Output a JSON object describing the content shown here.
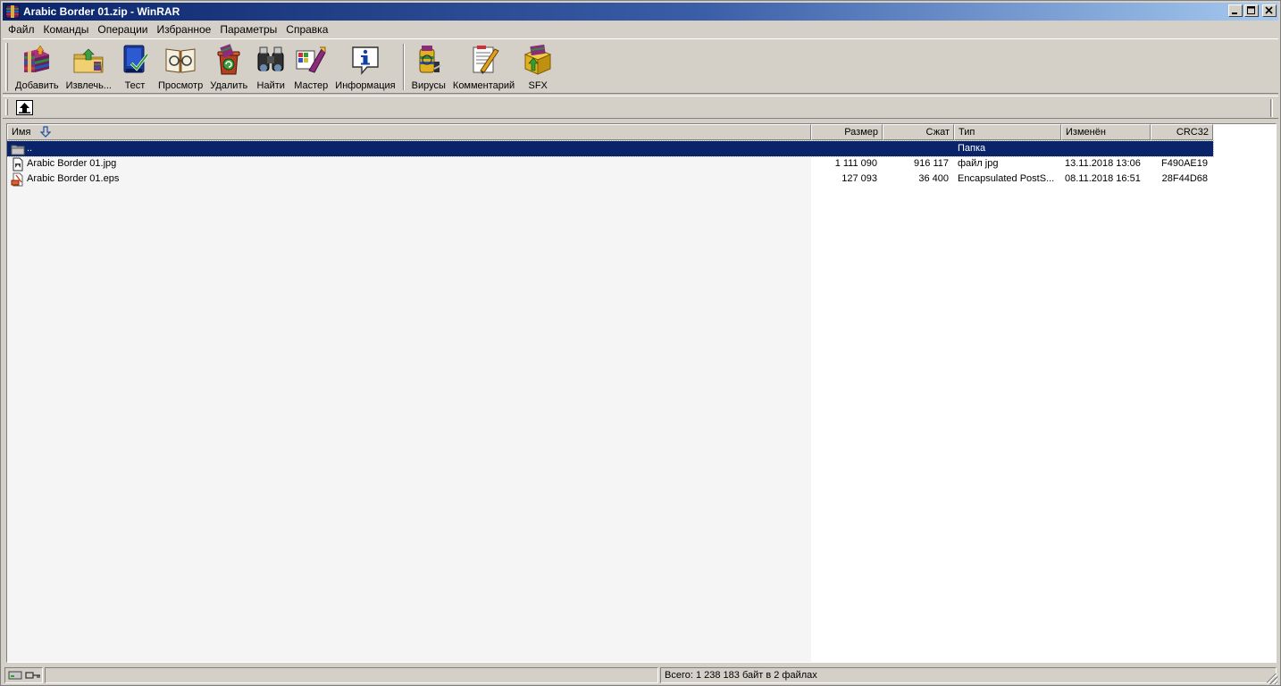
{
  "window": {
    "title": "Arabic Border 01.zip - WinRAR",
    "minimize": "_",
    "maximize": "□",
    "close": "✕"
  },
  "menu": [
    "Файл",
    "Команды",
    "Операции",
    "Избранное",
    "Параметры",
    "Справка"
  ],
  "toolbar": [
    {
      "label": "Добавить",
      "icon": "add-archive-icon"
    },
    {
      "label": "Извлечь...",
      "icon": "extract-icon"
    },
    {
      "label": "Тест",
      "icon": "test-icon"
    },
    {
      "label": "Просмотр",
      "icon": "view-icon"
    },
    {
      "label": "Удалить",
      "icon": "delete-icon"
    },
    {
      "label": "Найти",
      "icon": "find-icon"
    },
    {
      "label": "Мастер",
      "icon": "wizard-icon"
    },
    {
      "label": "Информация",
      "icon": "info-icon"
    },
    {
      "label": "Вирусы",
      "icon": "virus-scan-icon"
    },
    {
      "label": "Комментарий",
      "icon": "comment-icon"
    },
    {
      "label": "SFX",
      "icon": "sfx-icon"
    }
  ],
  "columns": {
    "name": "Имя",
    "size": "Размер",
    "packed": "Сжат",
    "type": "Тип",
    "modified": "Изменён",
    "crc": "CRC32"
  },
  "files": [
    {
      "name": "..",
      "size": "",
      "packed": "",
      "type": "Папка",
      "modified": "",
      "crc": "",
      "icon": "folder-up-icon",
      "selected": true
    },
    {
      "name": "Arabic Border 01.jpg",
      "size": "1 111 090",
      "packed": "916 117",
      "type": "файл jpg",
      "modified": "13.11.2018 13:06",
      "crc": "F490AE19",
      "icon": "jpg-file-icon",
      "selected": false
    },
    {
      "name": "Arabic Border 01.eps",
      "size": "127 093",
      "packed": "36 400",
      "type": "Encapsulated PostS...",
      "modified": "08.11.2018 16:51",
      "crc": "28F44D68",
      "icon": "eps-file-icon",
      "selected": false
    }
  ],
  "status": {
    "summary": "Всего: 1 238 183 байт в 2 файлах"
  }
}
